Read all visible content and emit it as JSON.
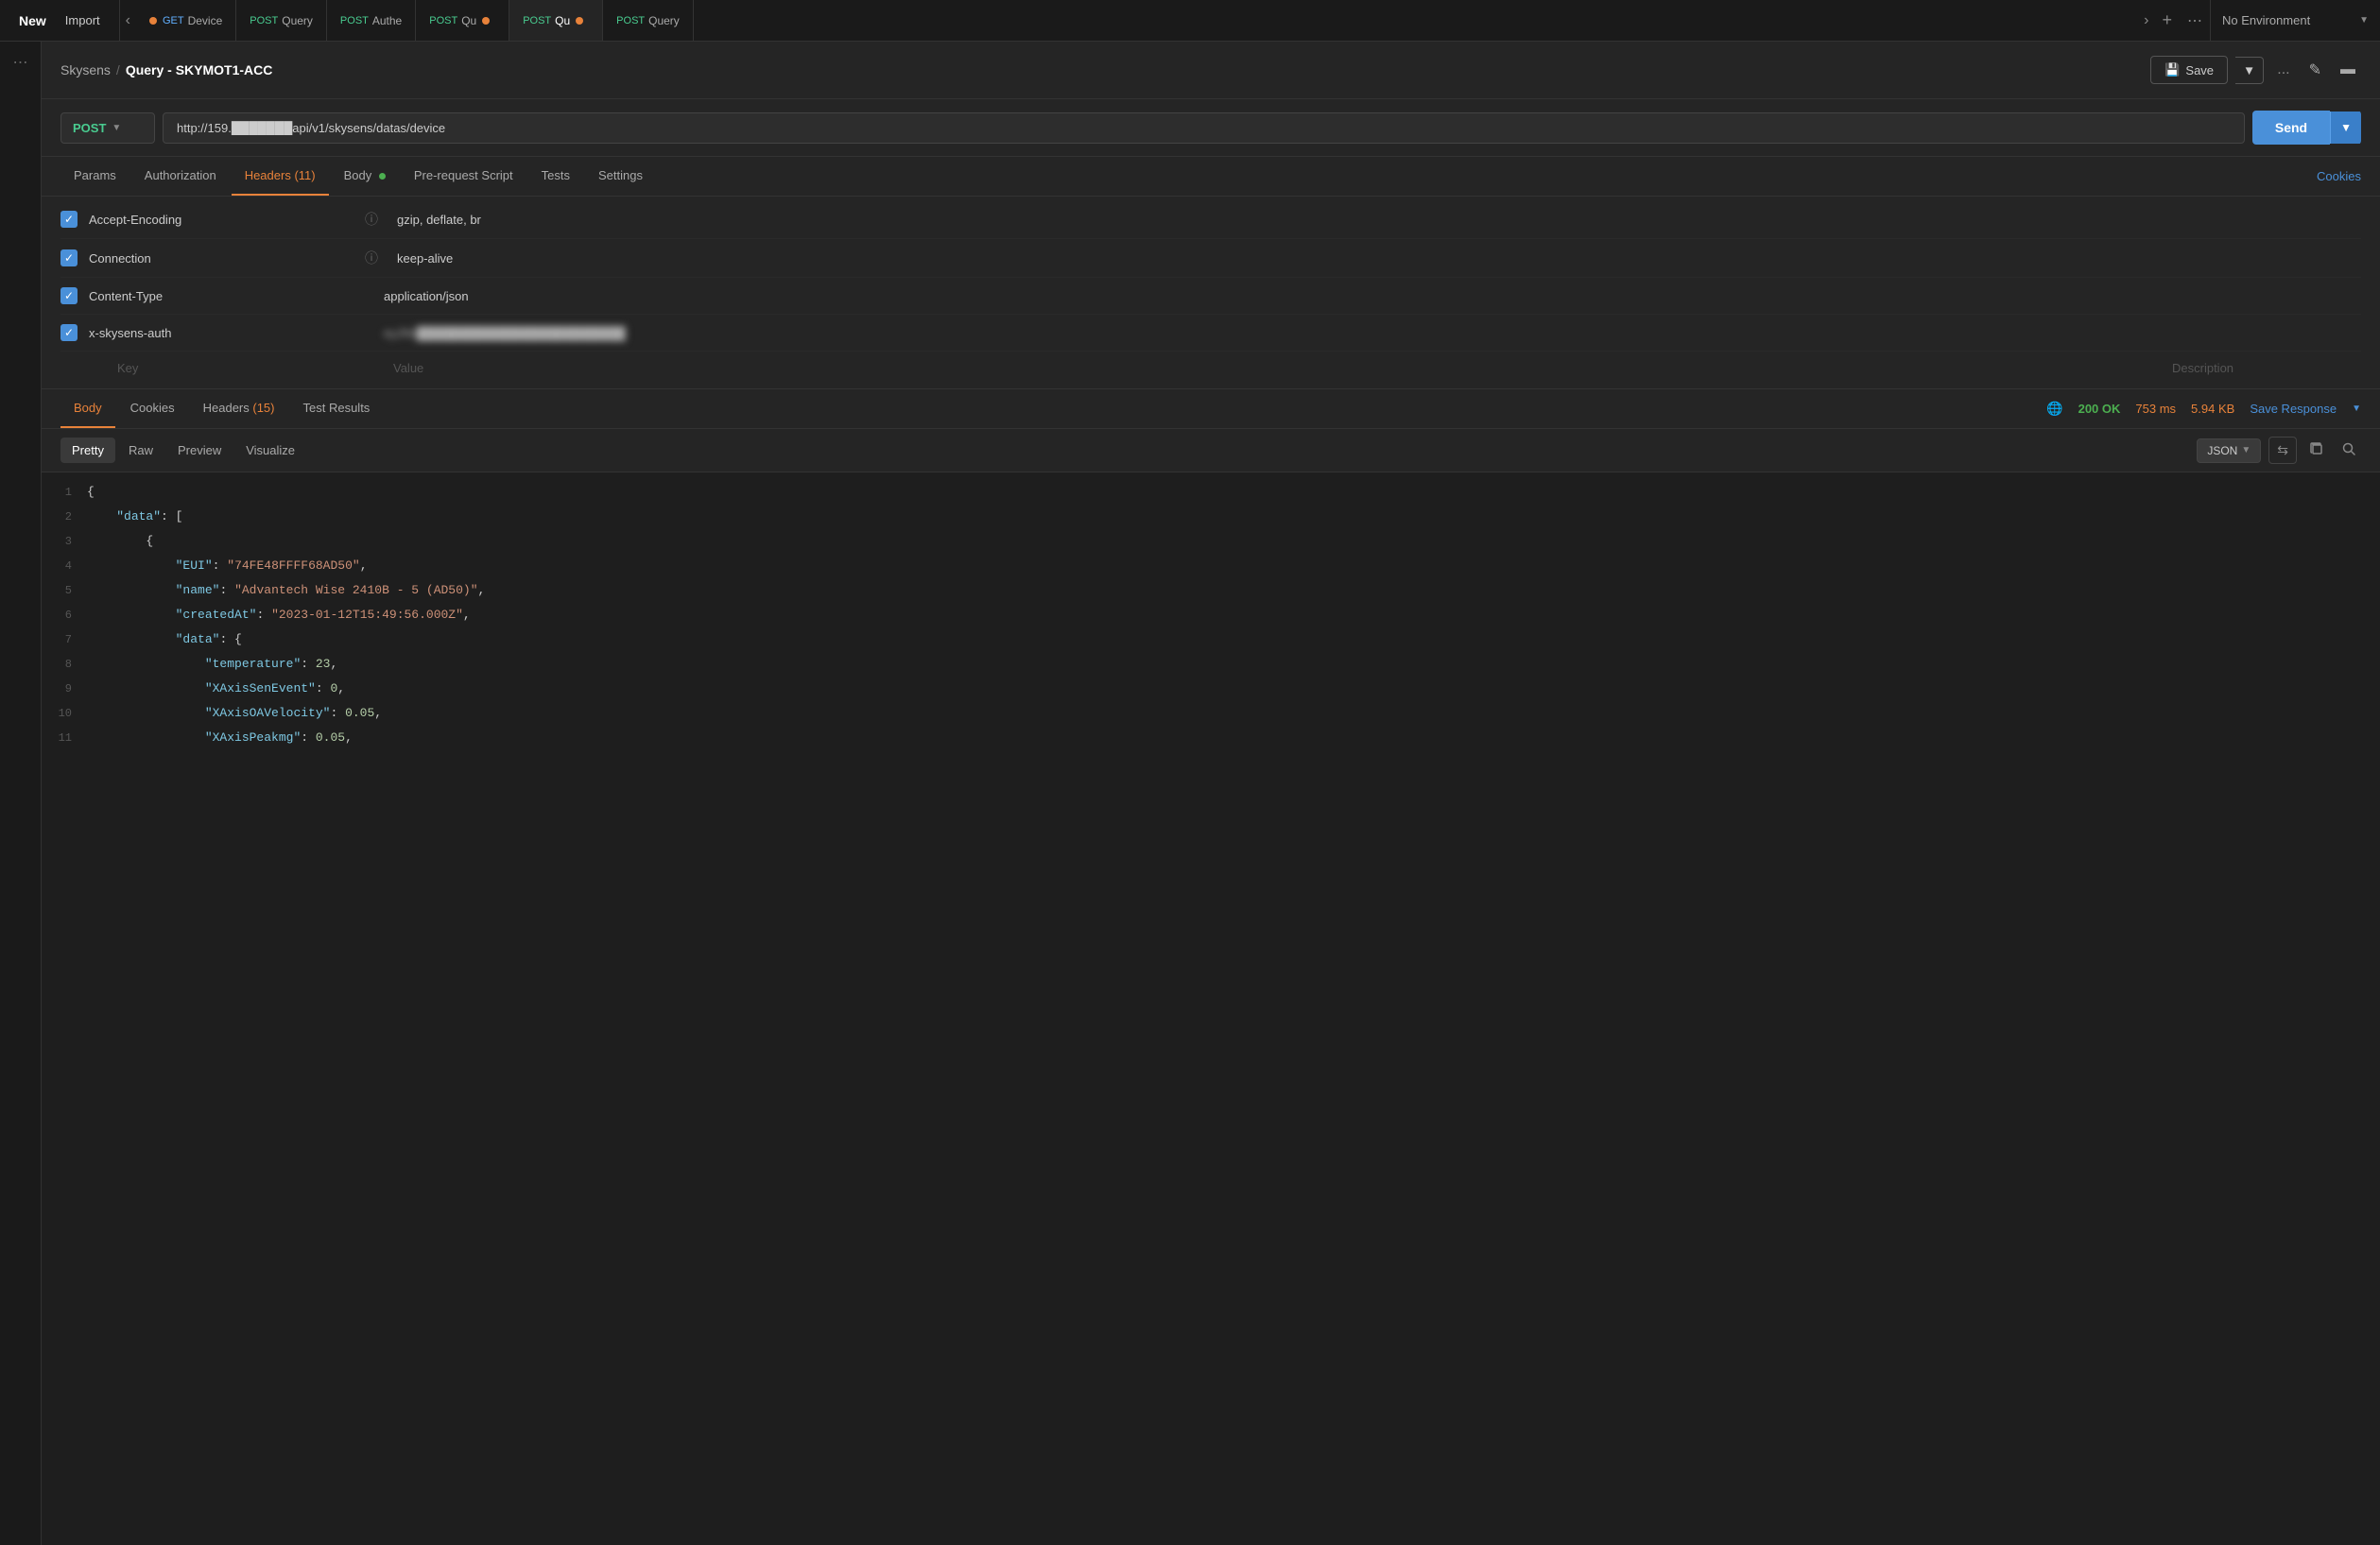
{
  "topbar": {
    "new_label": "New",
    "import_label": "Import",
    "env_label": "No Environment"
  },
  "tabs": [
    {
      "id": "tab1",
      "method": "GET",
      "method_class": "get",
      "name": "Device",
      "dot": false,
      "active": false
    },
    {
      "id": "tab2",
      "method": "POST",
      "method_class": "post",
      "name": "Query",
      "dot": false,
      "active": false
    },
    {
      "id": "tab3",
      "method": "POST",
      "method_class": "post",
      "name": "Authe",
      "dot": false,
      "active": false
    },
    {
      "id": "tab4",
      "method": "POST",
      "method_class": "post",
      "name": "Qu",
      "dot": true,
      "active": false
    },
    {
      "id": "tab5",
      "method": "POST",
      "method_class": "post",
      "name": "Qu",
      "dot": true,
      "active": true
    },
    {
      "id": "tab6",
      "method": "POST",
      "method_class": "post",
      "name": "Query",
      "dot": false,
      "active": false
    }
  ],
  "breadcrumb": {
    "collection": "Skysens",
    "separator": "/",
    "request_name": "Query - SKYMOT1-ACC"
  },
  "toolbar": {
    "save_label": "Save",
    "more_label": "..."
  },
  "request": {
    "method": "POST",
    "url": "http://159.█████████.api/v1/skysens/datas/device",
    "url_display": "http://159.███████api/v1/skysens/datas/device",
    "send_label": "Send"
  },
  "request_tabs": [
    {
      "id": "params",
      "label": "Params",
      "active": false,
      "badge": null,
      "dot": false
    },
    {
      "id": "authorization",
      "label": "Authorization",
      "active": false,
      "badge": null,
      "dot": false
    },
    {
      "id": "headers",
      "label": "Headers",
      "active": true,
      "badge": "(11)",
      "dot": false
    },
    {
      "id": "body",
      "label": "Body",
      "active": false,
      "badge": null,
      "dot": true
    },
    {
      "id": "pre-request",
      "label": "Pre-request Script",
      "active": false,
      "badge": null,
      "dot": false
    },
    {
      "id": "tests",
      "label": "Tests",
      "active": false,
      "badge": null,
      "dot": false
    },
    {
      "id": "settings",
      "label": "Settings",
      "active": false,
      "badge": null,
      "dot": false
    }
  ],
  "cookies_link": "Cookies",
  "headers": [
    {
      "checked": true,
      "key": "Accept-Encoding",
      "value": "gzip, deflate, br",
      "blurred": false
    },
    {
      "checked": true,
      "key": "Connection",
      "value": "keep-alive",
      "blurred": false
    },
    {
      "checked": true,
      "key": "Content-Type",
      "value": "application/json",
      "blurred": false
    },
    {
      "checked": true,
      "key": "x-skysens-auth",
      "value": "eyJhb██████████████████████",
      "blurred": true
    }
  ],
  "empty_row": {
    "key_placeholder": "Key",
    "value_placeholder": "Value",
    "desc_placeholder": "Description"
  },
  "response_tabs": [
    {
      "id": "body",
      "label": "Body",
      "active": true,
      "badge": null
    },
    {
      "id": "cookies",
      "label": "Cookies",
      "active": false,
      "badge": null
    },
    {
      "id": "headers",
      "label": "Headers",
      "active": false,
      "badge": "(15)"
    },
    {
      "id": "test-results",
      "label": "Test Results",
      "active": false,
      "badge": null
    }
  ],
  "response_meta": {
    "status": "200 OK",
    "time": "753 ms",
    "size": "5.94 KB",
    "save_label": "Save Response"
  },
  "format_tabs": [
    {
      "id": "pretty",
      "label": "Pretty",
      "active": true
    },
    {
      "id": "raw",
      "label": "Raw",
      "active": false
    },
    {
      "id": "preview",
      "label": "Preview",
      "active": false
    },
    {
      "id": "visualize",
      "label": "Visualize",
      "active": false
    }
  ],
  "json_format": "JSON",
  "code_lines": [
    {
      "num": 1,
      "content": "{",
      "type": "brace"
    },
    {
      "num": 2,
      "content": "    \"data\": [",
      "type": "mixed"
    },
    {
      "num": 3,
      "content": "        {",
      "type": "brace"
    },
    {
      "num": 4,
      "content": "            \"EUI\": \"74FE48FFFF68AD50\",",
      "type": "kv_string"
    },
    {
      "num": 5,
      "content": "            \"name\": \"Advantech Wise 2410B - 5 (AD50)\",",
      "type": "kv_string"
    },
    {
      "num": 6,
      "content": "            \"createdAt\": \"2023-01-12T15:49:56.000Z\",",
      "type": "kv_string"
    },
    {
      "num": 7,
      "content": "            \"data\": {",
      "type": "mixed"
    },
    {
      "num": 8,
      "content": "                \"temperature\": 23,",
      "type": "kv_number"
    },
    {
      "num": 9,
      "content": "                \"XAxisSenEvent\": 0,",
      "type": "kv_number"
    },
    {
      "num": 10,
      "content": "                \"XAxisOAVelocity\": 0.05,",
      "type": "kv_number"
    },
    {
      "num": 11,
      "content": "                \"XAxisPeakmg\": 0.05,",
      "type": "kv_number"
    }
  ]
}
